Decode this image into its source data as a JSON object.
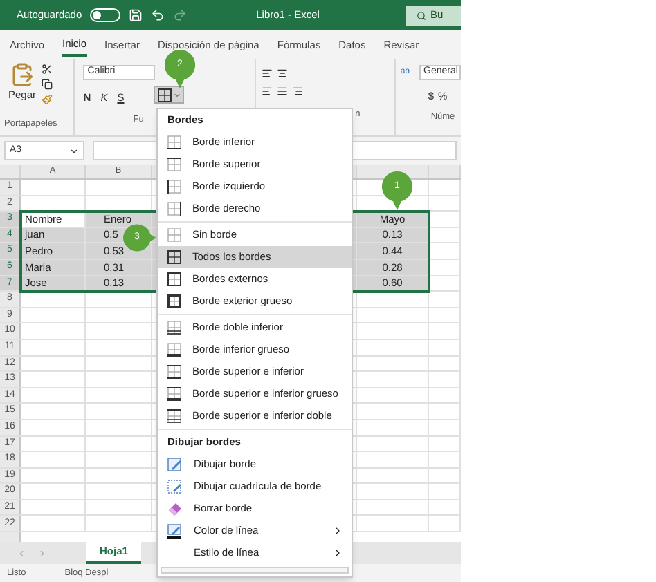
{
  "title_bar": {
    "autosave_label": "Autoguardado",
    "autosave_on": false,
    "title": "Libro1 - Excel",
    "search_placeholder": "Bu"
  },
  "tabs": [
    {
      "label": "Archivo",
      "selected": false
    },
    {
      "label": "Inicio",
      "selected": true
    },
    {
      "label": "Insertar",
      "selected": false
    },
    {
      "label": "Disposición de página",
      "selected": false
    },
    {
      "label": "Fórmulas",
      "selected": false
    },
    {
      "label": "Datos",
      "selected": false
    },
    {
      "label": "Revisar",
      "selected": false
    }
  ],
  "ribbon": {
    "paste_label": "Pegar",
    "font_name": "Calibri",
    "bold_label": "N",
    "italic_label": "K",
    "underline_label": "S",
    "wrap_label": "ab",
    "number_format": "General",
    "currency_label": "$",
    "percent_label": "%",
    "group_labels": [
      "Portapapeles",
      "Fu",
      "n",
      "Núme"
    ]
  },
  "formula_bar": {
    "name_box": "A3"
  },
  "sheet": {
    "columns": [
      "A",
      "B"
    ],
    "rows": [
      {
        "header": "1",
        "selected": false
      },
      {
        "header": "2",
        "selected": false
      },
      {
        "header": "3",
        "selected": true,
        "a": "Nombre",
        "b": "Enero",
        "e": "Mayo"
      },
      {
        "header": "4",
        "selected": true,
        "a": "juan",
        "b": "0.5",
        "e": "0.13"
      },
      {
        "header": "5",
        "selected": true,
        "a": "Pedro",
        "b": "0.53",
        "e": "0.44"
      },
      {
        "header": "6",
        "selected": true,
        "a": "Maria",
        "b": "0.31",
        "e": "0.28"
      },
      {
        "header": "7",
        "selected": true,
        "a": "Jose",
        "b": "0.13",
        "e": "0.60"
      },
      {
        "header": "8",
        "selected": false
      },
      {
        "header": "9",
        "selected": false
      },
      {
        "header": "10",
        "selected": false
      },
      {
        "header": "11",
        "selected": false
      },
      {
        "header": "12",
        "selected": false
      },
      {
        "header": "13",
        "selected": false
      },
      {
        "header": "14",
        "selected": false
      },
      {
        "header": "15",
        "selected": false
      },
      {
        "header": "16",
        "selected": false
      },
      {
        "header": "17",
        "selected": false
      },
      {
        "header": "18",
        "selected": false
      },
      {
        "header": "19",
        "selected": false
      },
      {
        "header": "20",
        "selected": false
      },
      {
        "header": "21",
        "selected": false
      },
      {
        "header": "22",
        "selected": false
      }
    ]
  },
  "menu": {
    "groups": [
      {
        "heading": "Bordes",
        "items": [
          {
            "label": "Borde inferior",
            "kind": "bottom",
            "selected": false
          },
          {
            "label": "Borde superior",
            "kind": "top",
            "selected": false
          },
          {
            "label": "Borde izquierdo",
            "kind": "left",
            "selected": false
          },
          {
            "label": "Borde derecho",
            "kind": "right",
            "selected": false
          }
        ]
      },
      {
        "items": [
          {
            "label": "Sin borde",
            "kind": "none",
            "selected": false
          },
          {
            "label": "Todos los bordes",
            "kind": "all",
            "selected": true
          },
          {
            "label": "Bordes externos",
            "kind": "outside",
            "selected": false
          },
          {
            "label": "Borde exterior grueso",
            "kind": "thickbox",
            "selected": false
          }
        ]
      },
      {
        "items": [
          {
            "label": "Borde doble inferior",
            "kind": "doublebottom",
            "selected": false
          },
          {
            "label": "Borde inferior grueso",
            "kind": "thickbottom",
            "selected": false
          },
          {
            "label": "Borde superior e inferior",
            "kind": "topbottom",
            "selected": false
          },
          {
            "label": "Borde superior e inferior grueso",
            "kind": "topthickbottom",
            "selected": false
          },
          {
            "label": "Borde superior e inferior doble",
            "kind": "topdoublebottom",
            "selected": false
          }
        ]
      },
      {
        "heading": "Dibujar bordes",
        "items": [
          {
            "label": "Dibujar borde",
            "kind": "draw",
            "selected": false
          },
          {
            "label": "Dibujar cuadrícula de borde",
            "kind": "drawgrid",
            "selected": false
          },
          {
            "label": "Borrar borde",
            "kind": "erase",
            "selected": false
          },
          {
            "label": "Color de línea",
            "kind": "linecolor",
            "selected": false,
            "submenu": true
          },
          {
            "label": "Estilo de línea",
            "kind": "linestyle",
            "selected": false,
            "submenu": true
          }
        ]
      }
    ]
  },
  "callouts": [
    "1",
    "2",
    "3"
  ],
  "sheet_tabs": [
    {
      "label": "Hoja1",
      "selected": true
    }
  ],
  "status_bar": [
    "Listo",
    "Bloq Despl"
  ]
}
